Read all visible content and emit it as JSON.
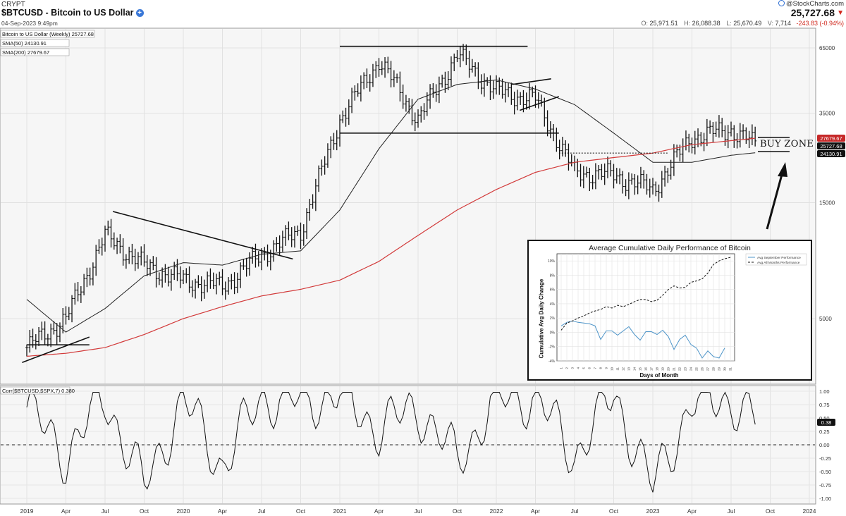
{
  "header": {
    "exchange": "CRYPT",
    "title": "$BTCUSD - Bitcoin to US Dollar",
    "date": "04-Sep-2023 9:49pm",
    "brand": "@StockCharts.com",
    "price": "25,727.68",
    "change": "-243.83 (-0.94%)",
    "ohlc": {
      "o_label": "O:",
      "o": "25,971.51",
      "h_label": "H:",
      "h": "26,088.38",
      "l_label": "L:",
      "l": "25,670.49",
      "v_label": "V:",
      "v": "7,714"
    }
  },
  "legend": {
    "main": "Bitcoin to US Dollar (Weekly) 25727.68",
    "sma50": "SMA(50) 24130.91",
    "sma200": "SMA(200) 27679.67",
    "corr": "Corr($BTCUSD,$SPX,7) 0.380"
  },
  "annotation": {
    "buy_zone": "BUY ZONE"
  },
  "colors": {
    "price": "#111111",
    "sma50": "#222222",
    "sma200": "#d23a3a",
    "corr": "#111111",
    "inset_blue": "#4d94c8"
  },
  "price_axis": {
    "ticks": [
      "65000",
      "35000",
      "15000",
      "5000"
    ],
    "badges": {
      "sma200": "27679.67",
      "last": "25727.68",
      "sma50": "24130.91"
    }
  },
  "corr_axis": {
    "ticks": [
      "1.00",
      "0.75",
      "0.50",
      "0.25",
      "0.00",
      "-0.25",
      "-0.50",
      "-0.75",
      "-1.00"
    ],
    "badge": "0.38"
  },
  "x_axis": {
    "labels": [
      "2019",
      "Apr",
      "Jul",
      "Oct",
      "2020",
      "Apr",
      "Jul",
      "Oct",
      "2021",
      "Apr",
      "Jul",
      "Oct",
      "2022",
      "Apr",
      "Jul",
      "Oct",
      "2023",
      "Apr",
      "Jul",
      "Oct",
      "2024"
    ]
  },
  "inset": {
    "title": "Average Cumulative Daily Performance of Bitcoin",
    "xlabel": "Days of Month",
    "ylabel": "Cumulative Avg Daily Change",
    "yticks": [
      "10%",
      "8%",
      "6%",
      "4%",
      "2%",
      "0%",
      "-2%",
      "-4%"
    ],
    "legend_sep": "Avg September Performance",
    "legend_all": "Avg All Months Performance"
  },
  "chart_data": [
    {
      "type": "line",
      "title": "$BTCUSD - Bitcoin to US Dollar",
      "scale": "log",
      "x": [
        "2019-01",
        "2019-04",
        "2019-07",
        "2019-10",
        "2020-01",
        "2020-04",
        "2020-07",
        "2020-10",
        "2021-01",
        "2021-04",
        "2021-07",
        "2021-10",
        "2022-01",
        "2022-04",
        "2022-07",
        "2022-10",
        "2023-01",
        "2023-04",
        "2023-07",
        "2023-09"
      ],
      "series": [
        {
          "name": "Bitcoin to US Dollar (Weekly)",
          "values": [
            3800,
            5000,
            11000,
            8300,
            7200,
            6800,
            9200,
            11500,
            33000,
            58000,
            33000,
            61000,
            43000,
            40000,
            20000,
            19500,
            17000,
            28000,
            30000,
            25727.68
          ]
        },
        {
          "name": "SMA(50)",
          "values": [
            6000,
            4400,
            5500,
            7500,
            8500,
            8300,
            9200,
            9500,
            14000,
            25000,
            40000,
            46000,
            48000,
            44000,
            38000,
            29000,
            22000,
            22000,
            23500,
            24130.91
          ]
        },
        {
          "name": "SMA(200)",
          "values": [
            3500,
            3600,
            3800,
            4300,
            5000,
            5600,
            6200,
            6600,
            7200,
            8600,
            11000,
            14000,
            17000,
            20000,
            22000,
            23000,
            24000,
            26000,
            27000,
            27679.67
          ]
        }
      ],
      "ylim": [
        2800,
        80000
      ]
    },
    {
      "type": "line",
      "title": "Corr($BTCUSD,$SPX,7)",
      "series": [
        {
          "name": "Corr($BTCUSD,$SPX,7)",
          "values": [
            0.7,
            -0.2,
            0.9,
            -0.8,
            0.85,
            -0.4,
            0.9,
            0.8,
            0.95,
            0.3,
            0.7,
            -0.3,
            0.85,
            0.9,
            -0.2,
            0.95,
            -0.8,
            0.8,
            0.85,
            0.38
          ]
        }
      ],
      "ylim": [
        -1,
        1
      ]
    },
    {
      "type": "line",
      "title": "Average Cumulative Daily Performance of Bitcoin",
      "xlabel": "Days of Month",
      "ylabel": "Cumulative Avg Daily Change",
      "categories": [
        "1",
        "2",
        "3",
        "4",
        "5",
        "6",
        "7",
        "8",
        "9",
        "10",
        "11",
        "12",
        "13",
        "14",
        "15",
        "16",
        "17",
        "18",
        "19",
        "20",
        "21",
        "22",
        "23",
        "24",
        "25",
        "26",
        "27",
        "28",
        "29",
        "30",
        "31"
      ],
      "series": [
        {
          "name": "Avg September Performance",
          "values": [
            0.9,
            1.4,
            1.6,
            1.4,
            1.3,
            1.2,
            0.9,
            -1.0,
            0.2,
            0.2,
            -0.4,
            0.2,
            0.8,
            -0.3,
            -1.1,
            0.1,
            0.1,
            -0.3,
            0.3,
            -0.6,
            -2.4,
            -1.0,
            -0.4,
            -1.7,
            -2.2,
            -3.6,
            -2.6,
            -3.4,
            -3.6,
            -2.2,
            null
          ]
        },
        {
          "name": "Avg All Months Performance",
          "values": [
            0.3,
            1.3,
            1.6,
            2.0,
            2.3,
            2.7,
            3.0,
            3.2,
            3.6,
            3.4,
            3.8,
            3.6,
            3.9,
            4.3,
            4.6,
            4.6,
            4.3,
            4.5,
            5.2,
            6.0,
            6.5,
            6.2,
            6.3,
            7.0,
            7.2,
            7.5,
            8.3,
            9.5,
            10.0,
            10.3,
            10.5
          ]
        }
      ],
      "ylim": [
        -4,
        11
      ]
    }
  ]
}
